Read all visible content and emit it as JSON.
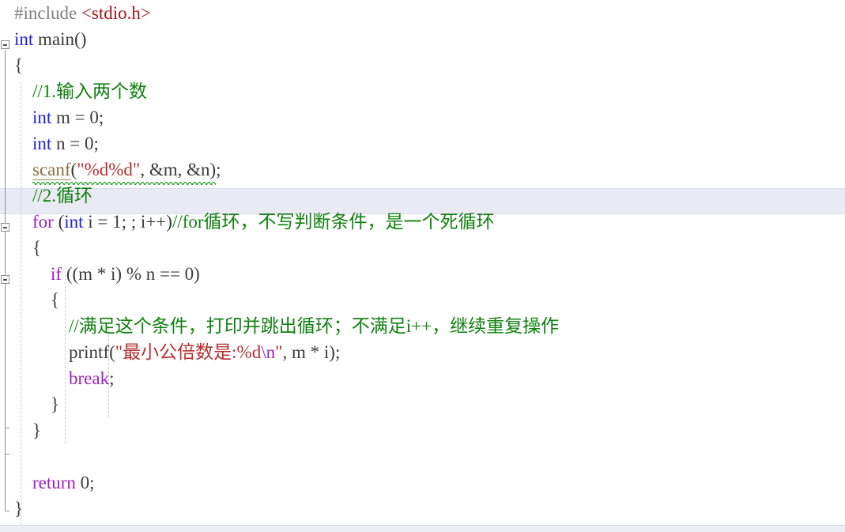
{
  "editor": {
    "language": "c",
    "font_size_px": 23,
    "line_height_px": 33,
    "background": "#ffffff",
    "current_line_highlight_color": "#eaeaf4",
    "current_line_number": 8
  },
  "colors": {
    "preprocessor": "#808080",
    "include_path": "#a31515",
    "type_keyword": "#2020e0",
    "control_keyword": "#a020c0",
    "comment": "#108010",
    "string": "#b43030",
    "escape": "#a020c0",
    "plain": "#3b3b3b",
    "error_squiggle": "#1a9a1a",
    "fold_marker": "#8d8d8d",
    "indent_guide": "#c9c9c9"
  },
  "lines": [
    {
      "n": 1,
      "text": "#include <stdio.h>"
    },
    {
      "n": 2,
      "text": "int main()"
    },
    {
      "n": 3,
      "text": "{"
    },
    {
      "n": 4,
      "text": "    //1.输入两个数"
    },
    {
      "n": 5,
      "text": "    int m = 0;"
    },
    {
      "n": 6,
      "text": "    int n = 0;"
    },
    {
      "n": 7,
      "text": "    scanf(\"%d%d\", &m, &n);"
    },
    {
      "n": 8,
      "text": "    //2.循环"
    },
    {
      "n": 9,
      "text": "    for (int i = 1; ; i++)//for循环，不写判断条件，是一个死循环"
    },
    {
      "n": 10,
      "text": "    {"
    },
    {
      "n": 11,
      "text": "        if ((m * i) % n == 0)"
    },
    {
      "n": 12,
      "text": "        {"
    },
    {
      "n": 13,
      "text": "            //满足这个条件，打印并跳出循环；不满足i++，继续重复操作"
    },
    {
      "n": 14,
      "text": "            printf(\"最小公倍数是:%d\\n\", m * i);"
    },
    {
      "n": 15,
      "text": "            break;"
    },
    {
      "n": 16,
      "text": "        }"
    },
    {
      "n": 17,
      "text": "    }"
    },
    {
      "n": 18,
      "text": ""
    },
    {
      "n": 19,
      "text": "    return 0;"
    },
    {
      "n": 20,
      "text": "}"
    }
  ],
  "tokens": {
    "l1": {
      "pp": "#include ",
      "inc": "<stdio.h>"
    },
    "l2": {
      "type": "int",
      "sp": " ",
      "name": "main",
      "parens": "()"
    },
    "l3": {
      "brace": "{"
    },
    "l4": {
      "indent": "    ",
      "comment": "//1.输入两个数"
    },
    "l5": {
      "indent": "    ",
      "type": "int",
      "rest": " m = 0;"
    },
    "l6": {
      "indent": "    ",
      "type": "int",
      "rest": " n = 0;"
    },
    "l7": {
      "indent": "    ",
      "fn": "scanf",
      "open": "(",
      "str": "\"%d%d\"",
      "mid": ", ",
      "amp_m": "&m",
      "mid2": ", ",
      "amp_n": "&n",
      "close": ")",
      "semi": ";"
    },
    "l8": {
      "indent": "    ",
      "comment": "//2.循环"
    },
    "l9": {
      "indent": "    ",
      "kw": "for",
      "a": " (",
      "type": "int",
      "b": " i = 1; ; i++)",
      "comment": "//for循环，不写判断条件，是一个死循环"
    },
    "l10": {
      "indent": "    ",
      "brace": "{"
    },
    "l11": {
      "indent": "        ",
      "kw": "if",
      "rest": " ((m * i) % n == 0)"
    },
    "l12": {
      "indent": "        ",
      "brace": "{"
    },
    "l13": {
      "indent": "            ",
      "comment": "//满足这个条件，打印并跳出循环；不满足i++，继续重复操作"
    },
    "l14": {
      "indent": "            ",
      "fn": "printf",
      "open": "(",
      "str_a": "\"最小公倍数是:%d",
      "esc": "\\n",
      "str_b": "\"",
      "rest": ", m * i);"
    },
    "l15": {
      "indent": "            ",
      "kw": "break",
      "semi": ";"
    },
    "l16": {
      "indent": "        ",
      "brace": "}"
    },
    "l17": {
      "indent": "    ",
      "brace": "}"
    },
    "l18": {
      "blank": ""
    },
    "l19": {
      "indent": "    ",
      "kw": "return",
      "rest": " 0;"
    },
    "l20": {
      "brace": "}"
    }
  }
}
